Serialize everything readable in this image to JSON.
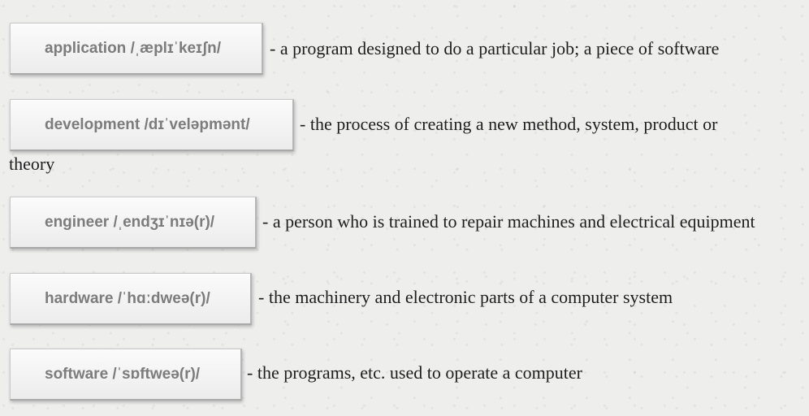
{
  "entries": [
    {
      "term": "application /ˌæplɪˈkeɪʃn/",
      "definition": "- a program designed to do a particular job; a piece of software"
    },
    {
      "term": "development /dɪˈveləpmənt/",
      "definition": "- the process of creating a new method, system, product or",
      "definition_cont": "theory"
    },
    {
      "term": "engineer /ˌendʒɪˈnɪə(r)/",
      "definition": "- a person who is trained to repair machines and electrical equipment"
    },
    {
      "term": "hardware /ˈhɑːdweə(r)/",
      "definition": "- the machinery and electronic parts of a computer system"
    },
    {
      "term": "software /ˈsɒftweə(r)/",
      "definition": "- the programs, etc. used to operate a computer"
    }
  ]
}
